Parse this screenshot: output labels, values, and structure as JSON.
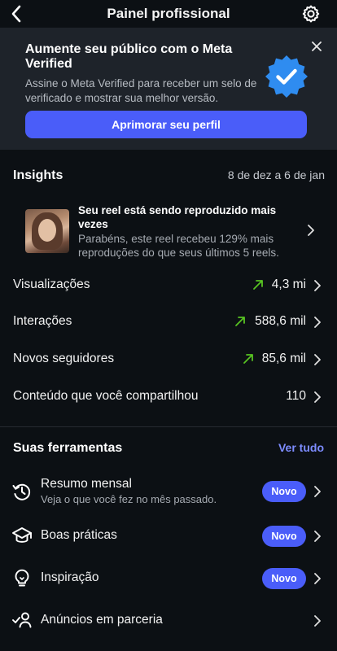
{
  "header": {
    "title": "Painel profissional"
  },
  "banner": {
    "title": "Aumente seu público com o Meta Verified",
    "description": "Assine o Meta Verified para receber um selo de verificado e mostrar sua melhor versão.",
    "cta": "Aprimorar seu perfil"
  },
  "insights": {
    "title": "Insights",
    "date_range": "8 de dez a 6 de jan",
    "reel": {
      "title": "Seu reel está sendo reproduzido mais vezes",
      "description": "Parabéns, este reel recebeu 129% mais reproduções do que seus últimos 5 reels."
    },
    "metrics": [
      {
        "label": "Visualizações",
        "value": "4,3 mi",
        "trend": "up"
      },
      {
        "label": "Interações",
        "value": "588,6 mil",
        "trend": "up"
      },
      {
        "label": "Novos seguidores",
        "value": "85,6 mil",
        "trend": "up"
      },
      {
        "label": "Conteúdo que você compartilhou",
        "value": "110"
      }
    ]
  },
  "tools": {
    "title": "Suas ferramentas",
    "see_all": "Ver tudo",
    "items": [
      {
        "label": "Resumo mensal",
        "sublabel": "Veja o que você fez no mês passado.",
        "badge": "Novo",
        "icon": "history-icon"
      },
      {
        "label": "Boas práticas",
        "badge": "Novo",
        "icon": "graduation-cap-icon"
      },
      {
        "label": "Inspiração",
        "badge": "Novo",
        "icon": "lightbulb-icon"
      },
      {
        "label": "Anúncios em parceria",
        "icon": "partner-ads-icon"
      }
    ]
  },
  "colors": {
    "background": "#0c1014",
    "banner": "#1e232a",
    "accent": "#4a5df9",
    "link": "#7d8cff",
    "trend_up": "#58c322"
  }
}
